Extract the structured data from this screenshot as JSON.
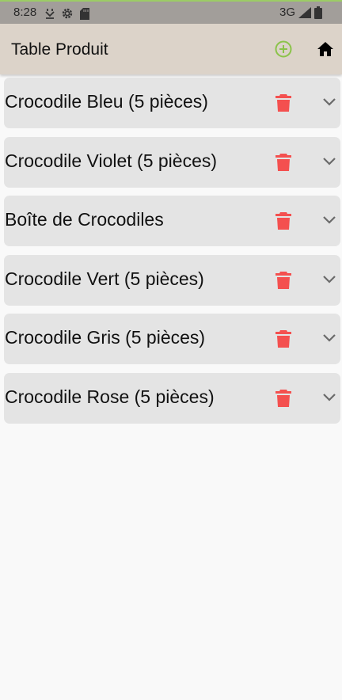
{
  "status_bar": {
    "time": "8:28",
    "network": "3G",
    "icons": [
      "download-icon",
      "settings-icon",
      "sd-card-icon",
      "signal-icon",
      "battery-icon"
    ]
  },
  "app_bar": {
    "title": "Table Produit",
    "add_icon": "add-circle-icon",
    "home_icon": "home-icon",
    "accent_color": "#8bc34a"
  },
  "products": [
    {
      "label": "Crocodile Bleu (5 pièces)"
    },
    {
      "label": "Crocodile Violet (5 pièces)"
    },
    {
      "label": "Boîte de Crocodiles"
    },
    {
      "label": "Crocodile Vert (5 pièces)"
    },
    {
      "label": "Crocodile Gris (5 pièces)"
    },
    {
      "label": "Crocodile Rose (5 pièces)"
    }
  ],
  "item_actions": {
    "delete_icon": "trash-icon",
    "delete_color": "#f4504f",
    "expand_icon": "chevron-down-icon"
  }
}
